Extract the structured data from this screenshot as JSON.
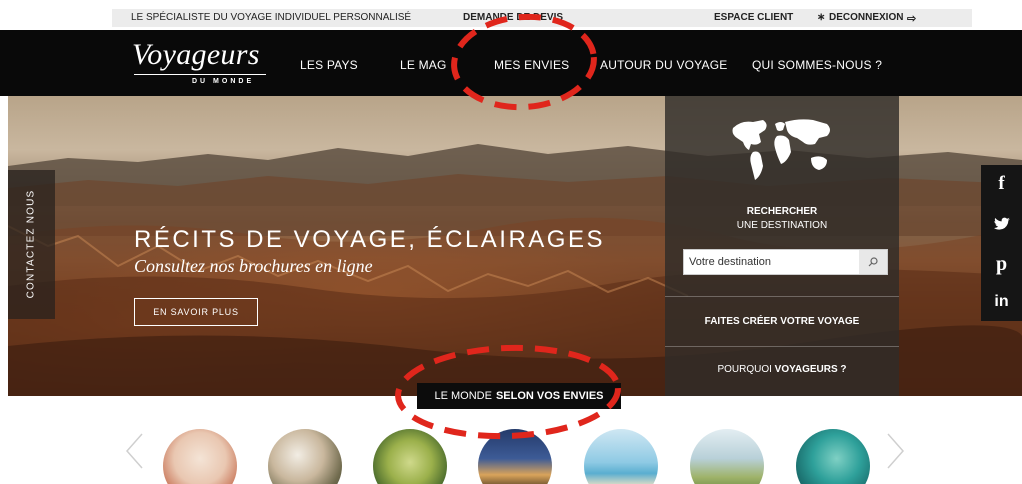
{
  "topbar": {
    "tagline": "LE SPÉCIALISTE DU VOYAGE INDIVIDUEL PERSONNALISÉ",
    "devis": "DEMANDE DE DEVIS",
    "client": "ESPACE CLIENT",
    "separator": "∗",
    "logout": "DECONNEXION",
    "logout_icon": "⇨"
  },
  "logo": {
    "brand": "Voyageurs",
    "sub": "DU MONDE"
  },
  "nav": {
    "pays": "LES PAYS",
    "mag": "LE MAG",
    "envies": "MES ENVIES",
    "autour": "AUTOUR DU VOYAGE",
    "qui": "QUI SOMMES-NOUS ?"
  },
  "hero": {
    "title": "RÉCITS DE VOYAGE, ÉCLAIRAGES",
    "subtitle": "Consultez nos brochures en ligne",
    "button": "EN SAVOIR PLUS"
  },
  "contact_tab": "CONTACTEZ NOUS",
  "search_panel": {
    "title": "RECHERCHER",
    "subtitle": "UNE DESTINATION",
    "placeholder": "Votre destination",
    "cta1": "FAITES CRÉER VOTRE VOYAGE",
    "cta2_prefix": "POURQUOI",
    "cta2_bold": "VOYAGEURS ?"
  },
  "social": {
    "facebook": "f",
    "twitter_icon": "twitter-bird",
    "pinterest": "p",
    "linkedin": "in"
  },
  "envies_label": {
    "prefix": "LE MONDE",
    "bold": "SELON VOS ENVIES"
  },
  "carousel": {
    "items": [
      {
        "icon": "photo-hotel-room"
      },
      {
        "icon": "photo-temple"
      },
      {
        "icon": "photo-market-fruit"
      },
      {
        "icon": "photo-lodge"
      },
      {
        "icon": "photo-beach"
      },
      {
        "icon": "photo-hikers"
      },
      {
        "icon": "photo-sea-terrace"
      }
    ]
  },
  "colors": {
    "nav_bg": "#090909",
    "annotation_red": "#e0261c",
    "panel_bg": "#302c28"
  }
}
